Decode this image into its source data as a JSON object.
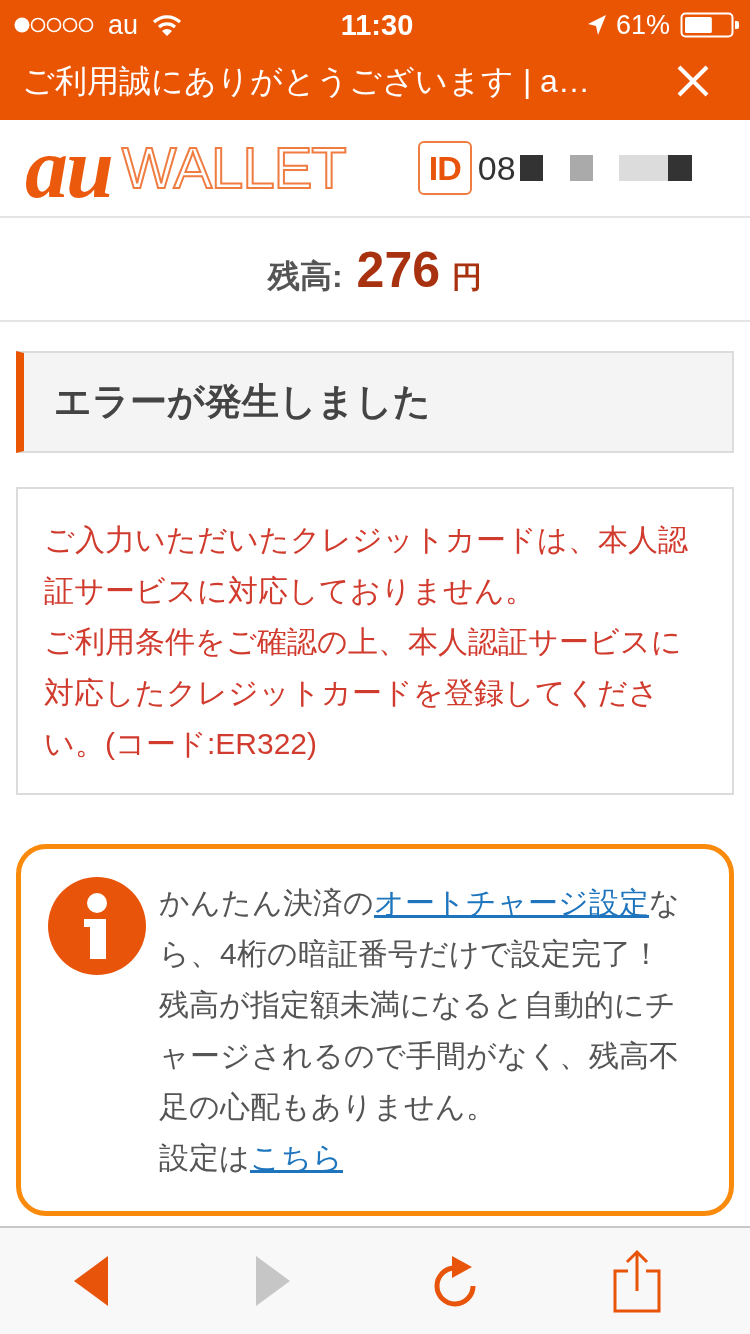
{
  "status_bar": {
    "carrier": "au",
    "time": "11:30",
    "battery": "61%"
  },
  "title_bar": {
    "title": "ご利用誠にありがとうございます | a…"
  },
  "header": {
    "logo": {
      "brand": "au",
      "product": "WALLET"
    },
    "id_badge": "ID",
    "id_number": "08"
  },
  "balance": {
    "label": "残高:",
    "amount": "276",
    "unit": "円"
  },
  "error": {
    "heading": "エラーが発生しました",
    "paragraphs": [
      "ご入力いただいたクレジットカードは、本人認証サービスに対応しておりません。",
      "ご利用条件をご確認の上、本人認証サービスに対応したクレジットカードを登録してください。(コード:ER322)"
    ]
  },
  "info": {
    "paragraphs": [
      {
        "parts": [
          {
            "kind": "text",
            "text": "かんたん決済の"
          },
          {
            "kind": "link",
            "text": "オートチャージ設定"
          },
          {
            "kind": "text",
            "text": "なら、4桁の暗証番号だけで設定完了！残高が指定額未満になると自動的にチャージされるので手間がなく、残高不足の心配もありません。"
          }
        ]
      },
      {
        "parts": [
          {
            "kind": "text",
            "text": "設定は"
          },
          {
            "kind": "link",
            "text": "こちら"
          }
        ]
      }
    ]
  },
  "toolbar": {
    "buttons": [
      {
        "kind": "back",
        "disabled": false
      },
      {
        "kind": "forward",
        "disabled": true
      },
      {
        "kind": "reload",
        "disabled": false
      },
      {
        "kind": "share",
        "disabled": false
      }
    ]
  }
}
